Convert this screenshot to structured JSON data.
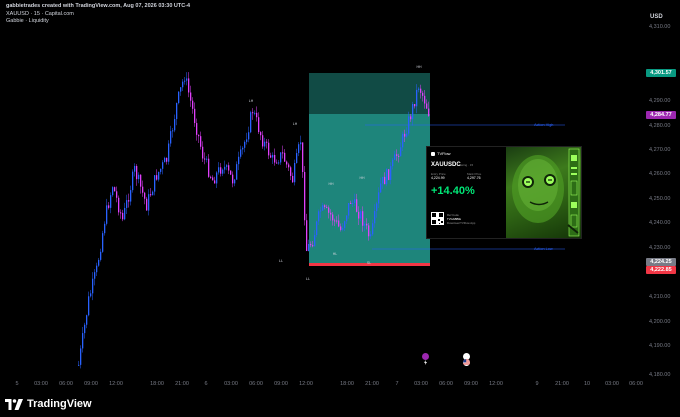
{
  "header": {
    "creator_line": "gabbietrades created with TradingView.com, Aug 07, 2026 03:30 UTC-4",
    "symbol_line": "XAUUSD · 15 · Capital.com",
    "indicator_line": "Gabbie · Liquidity"
  },
  "price_scale": {
    "currency": "USD",
    "labels": [
      "4,310.00",
      "4,290.00",
      "4,280.00",
      "4,270.00",
      "4,260.00",
      "4,250.00",
      "4,240.00",
      "4,230.00",
      "4,210.00",
      "4,200.00",
      "4,190.00",
      "4,180.00"
    ],
    "tags": {
      "current_price": {
        "text": "4,301.57",
        "color": "#089981"
      },
      "level_high": {
        "text": "4,284.77",
        "color": "#9c27b0"
      },
      "level_mid": {
        "text": "4,224.25",
        "color": "#787b86"
      },
      "level_low": {
        "text": "4,222.85",
        "color": "#f23645"
      }
    }
  },
  "time_axis": {
    "labels": [
      "5",
      "03:00",
      "06:00",
      "09:00",
      "12:00",
      "18:00",
      "21:00",
      "6",
      "03:00",
      "06:00",
      "09:00",
      "12:00",
      "18:00",
      "21:00",
      "7",
      "03:00",
      "06:00",
      "09:00",
      "12:00",
      "9",
      "21:00",
      "10",
      "03:00",
      "06:00"
    ]
  },
  "chart": {
    "annotations": {
      "lh_left": "LH",
      "lh_right": "LH",
      "ll_left": "LL",
      "ll_right": "LL",
      "hh": "HH",
      "hl": "HL",
      "hh_mid": "HH",
      "hh_top": "HH",
      "box_bottom": "SL"
    },
    "action_high": "Action High",
    "action_low": "Action Low",
    "colors": {
      "bull": "#2962ff",
      "bear": "#e040fb",
      "zone": "#26a69a"
    }
  },
  "card": {
    "brand": "TVFlow",
    "symbol": "XAUUSDC",
    "symbol_sub": "Swing · 15",
    "entry_label": "Entry Price",
    "entry_value": "4,224.99",
    "mark_label": "Mark Price",
    "mark_value": "4,297.76",
    "pnl_percent": "+14.40%",
    "qr_line1": "Ref Code",
    "qr_line2": "TVGABBIE",
    "qr_line3": "Download TVFlow App"
  },
  "footer": {
    "brand": "TradingView"
  }
}
